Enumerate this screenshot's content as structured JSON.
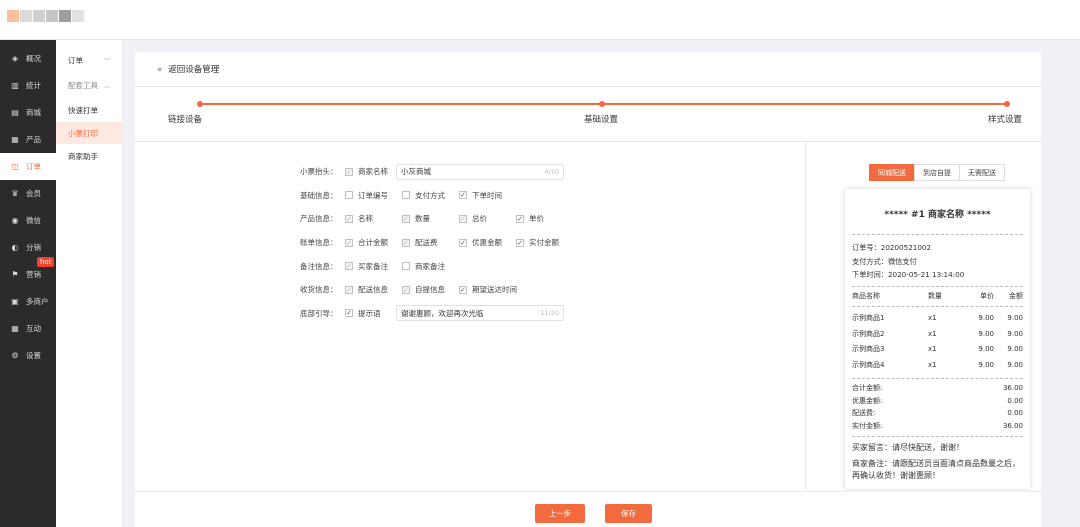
{
  "colors": {
    "accent": "#f26a3d",
    "sidebar_bg": "#2b2b2b"
  },
  "sidebar": [
    {
      "label": "概况",
      "icon": "layers-icon"
    },
    {
      "label": "统计",
      "icon": "chart-icon"
    },
    {
      "label": "商城",
      "icon": "shop-icon"
    },
    {
      "label": "产品",
      "icon": "grid-icon"
    },
    {
      "label": "订单",
      "icon": "order-icon"
    },
    {
      "label": "会员",
      "icon": "crown-icon"
    },
    {
      "label": "微信",
      "icon": "wechat-icon"
    },
    {
      "label": "分销",
      "icon": "users-icon"
    },
    {
      "label": "营销",
      "icon": "flag-icon"
    },
    {
      "label": "多商户",
      "icon": "store-icon"
    },
    {
      "label": "互动",
      "icon": "apps-icon"
    },
    {
      "label": "设置",
      "icon": "gear-icon"
    }
  ],
  "hot_badge": "hot",
  "subnav": {
    "order": "订单",
    "group": "配套工具",
    "items": [
      "快速打单",
      "小票打印",
      "商家助手"
    ]
  },
  "back_label": "返回设备管理",
  "steps": [
    "链接设备",
    "基础设置",
    "样式设置"
  ],
  "rows": [
    {
      "label": "小票抬头：",
      "options": [
        {
          "text": "商家名称",
          "state": "disabled"
        }
      ],
      "input": {
        "value": "小灰商城",
        "count": "4/10"
      }
    },
    {
      "label": "基础信息：",
      "options": [
        {
          "text": "订单编号",
          "state": "off"
        },
        {
          "text": "支付方式",
          "state": "off"
        },
        {
          "text": "下单时间",
          "state": "on"
        }
      ]
    },
    {
      "label": "产品信息：",
      "options": [
        {
          "text": "名称",
          "state": "disabled"
        },
        {
          "text": "数量",
          "state": "disabled"
        },
        {
          "text": "总价",
          "state": "disabled"
        },
        {
          "text": "单价",
          "state": "on"
        }
      ]
    },
    {
      "label": "账单信息：",
      "options": [
        {
          "text": "合计金额",
          "state": "disabled"
        },
        {
          "text": "配送费",
          "state": "disabled"
        },
        {
          "text": "优惠金额",
          "state": "on"
        },
        {
          "text": "实付金额",
          "state": "on"
        }
      ]
    },
    {
      "label": "备注信息：",
      "options": [
        {
          "text": "买家备注",
          "state": "disabled"
        },
        {
          "text": "商家备注",
          "state": "off"
        }
      ]
    },
    {
      "label": "收货信息：",
      "options": [
        {
          "text": "配送信息",
          "state": "disabled"
        },
        {
          "text": "自提信息",
          "state": "disabled"
        },
        {
          "text": "期望送达时间",
          "state": "on"
        }
      ]
    },
    {
      "label": "底部引导：",
      "options": [
        {
          "text": "提示语",
          "state": "on"
        }
      ],
      "input": {
        "value": "谢谢惠顾，欢迎再次光临",
        "count": "11/20"
      }
    }
  ],
  "tabs": [
    "同城配送",
    "到店自提",
    "无需配送"
  ],
  "receipt": {
    "title": "***** #1 商家名称 *****",
    "info": [
      "订单号：20200521002",
      "支付方式：微信支付",
      "下单时间：2020-05-21 13:14:00"
    ],
    "headers": [
      "商品名称",
      "数量",
      "单价",
      "金额"
    ],
    "items": [
      [
        "示例商品1",
        "x1",
        "9.00",
        "9.00"
      ],
      [
        "示例商品2",
        "x1",
        "9.00",
        "9.00"
      ],
      [
        "示例商品3",
        "x1",
        "9.00",
        "9.00"
      ],
      [
        "示例商品4",
        "x1",
        "9.00",
        "9.00"
      ]
    ],
    "sums": [
      [
        "合计金额:",
        "36.00"
      ],
      [
        "优惠金额:",
        "0.00"
      ],
      [
        "配送费:",
        "0.00"
      ],
      [
        "实付金额:",
        "36.00"
      ]
    ],
    "notes": [
      "买家留言：请尽快配送，谢谢！",
      "商家备注：请跟配送员当面清点商品数量之后，再确认收货！谢谢惠顾！"
    ]
  },
  "buttons": {
    "prev": "上一步",
    "save": "保存"
  }
}
